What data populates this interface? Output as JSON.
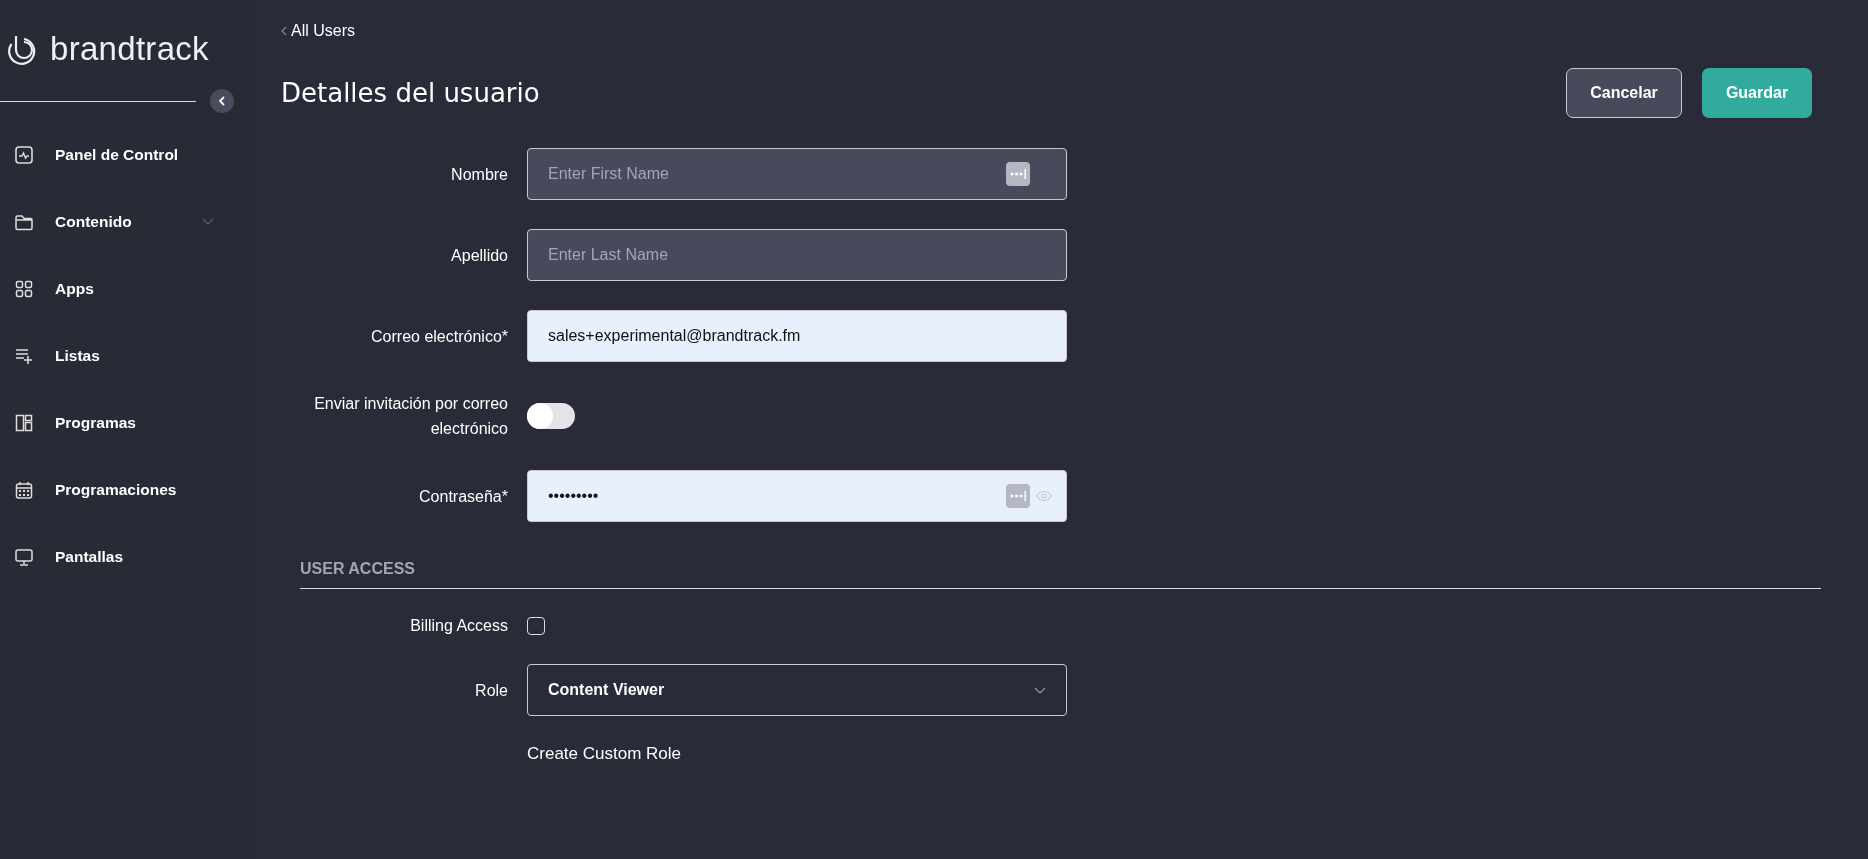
{
  "sidebar": {
    "logo": "brandtrack",
    "items": [
      {
        "label": "Panel de Control",
        "kind": "link"
      },
      {
        "label": "Contenido",
        "kind": "group"
      },
      {
        "label": "Apps",
        "kind": "link"
      },
      {
        "label": "Listas",
        "kind": "link"
      },
      {
        "label": "Programas",
        "kind": "link"
      },
      {
        "label": "Programaciones",
        "kind": "link"
      },
      {
        "label": "Pantallas",
        "kind": "link"
      }
    ]
  },
  "breadcrumb": "All Users",
  "title": "Detalles del usuario",
  "buttons": [
    {
      "label": "Cancelar",
      "kind": "secondary"
    },
    {
      "label": "Guardar",
      "kind": "primary"
    }
  ],
  "form": [
    {
      "label": "Nombre",
      "kind": "text",
      "placeholder": "Enter First Name",
      "autofill": true
    },
    {
      "label": "Apellido",
      "kind": "text",
      "placeholder": "Enter Last Name",
      "autofill": false
    },
    {
      "label": "Correo electrónico*",
      "kind": "filled",
      "value": "sales+experimental@brandtrack.fm"
    },
    {
      "label": "Enviar invitación por correo electrónico",
      "kind": "toggle",
      "on": false
    },
    {
      "label": "Contraseña*",
      "kind": "password",
      "value": "•••••••••"
    }
  ],
  "user_access": {
    "heading": "USER ACCESS",
    "rows": [
      {
        "label": "Billing Access",
        "kind": "checkbox",
        "checked": false
      },
      {
        "label": "Role",
        "kind": "select",
        "value": "Content Viewer"
      }
    ],
    "link": "Create Custom Role"
  }
}
